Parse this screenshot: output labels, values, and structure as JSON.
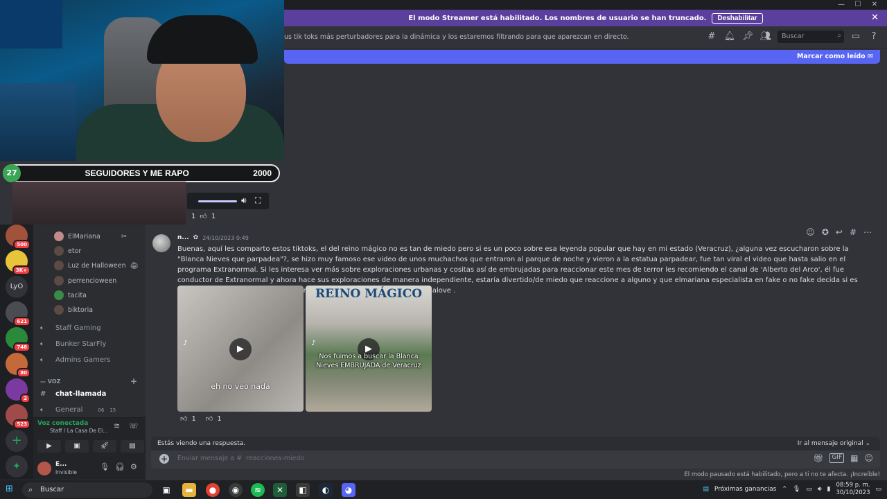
{
  "window": {
    "minimize": "—",
    "maximize": "☐",
    "close": "✕"
  },
  "streamer_banner": {
    "text": "El modo Streamer está habilitado. Los nombres de usuario se han truncado.",
    "button": "Deshabilitar",
    "close": "✕"
  },
  "channel_header": {
    "topic": "us tik toks más perturbadores para la dinámica y los estaremos filtrando para que aparezcan en directo.",
    "search_placeholder": "Buscar"
  },
  "new_messages_bar": {
    "label": "Marcar como leído"
  },
  "stream_overlay": {
    "goal_count": "27",
    "goal_text": "SEGUIDORES Y ME RAPO",
    "goal_target": "2000",
    "reactions": [
      "1",
      "1"
    ]
  },
  "servers": [
    {
      "badge": "500"
    },
    {
      "badge": "3K+"
    },
    {
      "label": "LyO"
    },
    {
      "badge": "621"
    },
    {
      "badge": "748"
    },
    {
      "badge": "80"
    },
    {
      "badge": "2"
    },
    {
      "badge": "523"
    }
  ],
  "sidebar": {
    "voice_users": [
      "ElMariana",
      "etor",
      "Luz de Halloween",
      "perrencioween",
      "tacita",
      "biktoria"
    ],
    "voice_channels": [
      "Staff Gaming",
      "Bunker StarFly",
      "Admins Gamers"
    ],
    "category": "— VOZ",
    "text_channel": "chat-llamada",
    "general_channel": "General",
    "general_counts": [
      "06",
      "15"
    ],
    "voice_status": "Voz conectada",
    "voice_location": "Staff / La Casa De El...",
    "user_name": "E...",
    "user_status": "Invisible"
  },
  "message": {
    "author": "n...",
    "timestamp": "24/10/2023 0:49",
    "body": "Buenas, aquí les comparto estos tiktoks, el del reino mágico no es tan de miedo pero si es un poco sobre esa leyenda popular que hay en mi estado (Veracruz), ¿alguna vez escucharon sobre la \"Blanca Nieves que parpadea\"?, se hizo muy famoso ese video de unos muchachos que entraron al parque de noche y vieron a la estatua parpadear, fue tan viral el video que hasta salio en el programa Extranormal. Si les interesa ver más sobre exploraciones urbanas y cositas así de embrujadas para reaccionar este mes de terror les recomiendo el canal de 'Alberto del Arco', él fue conductor de Extranormal y ahora hace sus exploraciones de manera independiente, estaría divertido/de miedo que reaccione a alguno y que elmariana especialista en fake o no fake decida si es verdad. No me banananien si no da miedo, yo los quiero mucho elmarianalove .",
    "video1_caption": "eh no veo nada",
    "video2_title": "REINO MÁGICO",
    "video2_caption": "Nos fuimos a buscar la Blanca Nieves EMBRUJADA de Veracruz",
    "reaction_count": "1",
    "reaction_count2": "1"
  },
  "composer": {
    "reply_notice": "Estás viendo una respuesta.",
    "jump_link": "Ir al mensaje original",
    "placeholder": "Enviar mensaje a #  ·reacciones-miedo",
    "paused_notice": "El modo pausado está habilitado, pero a ti no te afecta. ¡Increíble!"
  },
  "taskbar": {
    "search": "Buscar",
    "widget": "Próximas ganancias",
    "time": "08:59 p. m.",
    "date": "30/10/2023"
  },
  "colors": {
    "brand": "#5865f2",
    "streamer_banner": "#5a3f9c",
    "badge": "#f23f43",
    "voice_connected": "#23a55a"
  }
}
